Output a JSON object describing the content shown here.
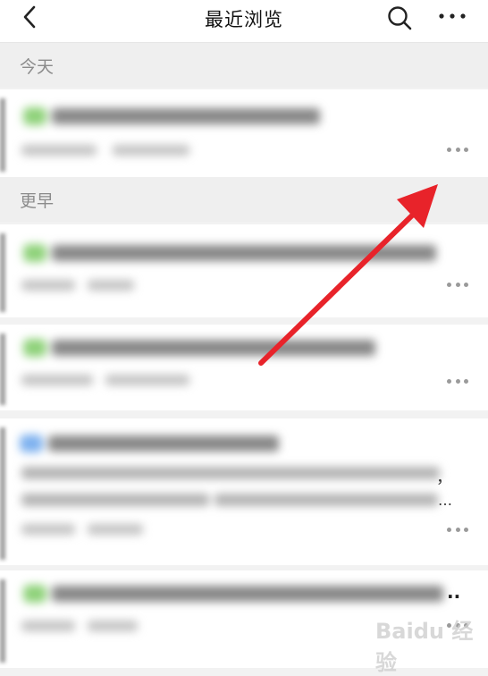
{
  "nav": {
    "title": "最近浏览",
    "back_icon": "chevron-left-icon",
    "search_icon": "search-icon",
    "more_icon": "more-horizontal-icon"
  },
  "sections": {
    "today": "今天",
    "earlier": "更早"
  },
  "card3_trailing": "，",
  "card3_ellipsis": "…",
  "card4_ellipsis": "..",
  "watermark": "Baidu 经验",
  "colors": {
    "accent_arrow": "#e8232a",
    "green_badge": "#8fd27a",
    "blue_badge": "#7fb2ef",
    "section_bg": "#efefef"
  }
}
